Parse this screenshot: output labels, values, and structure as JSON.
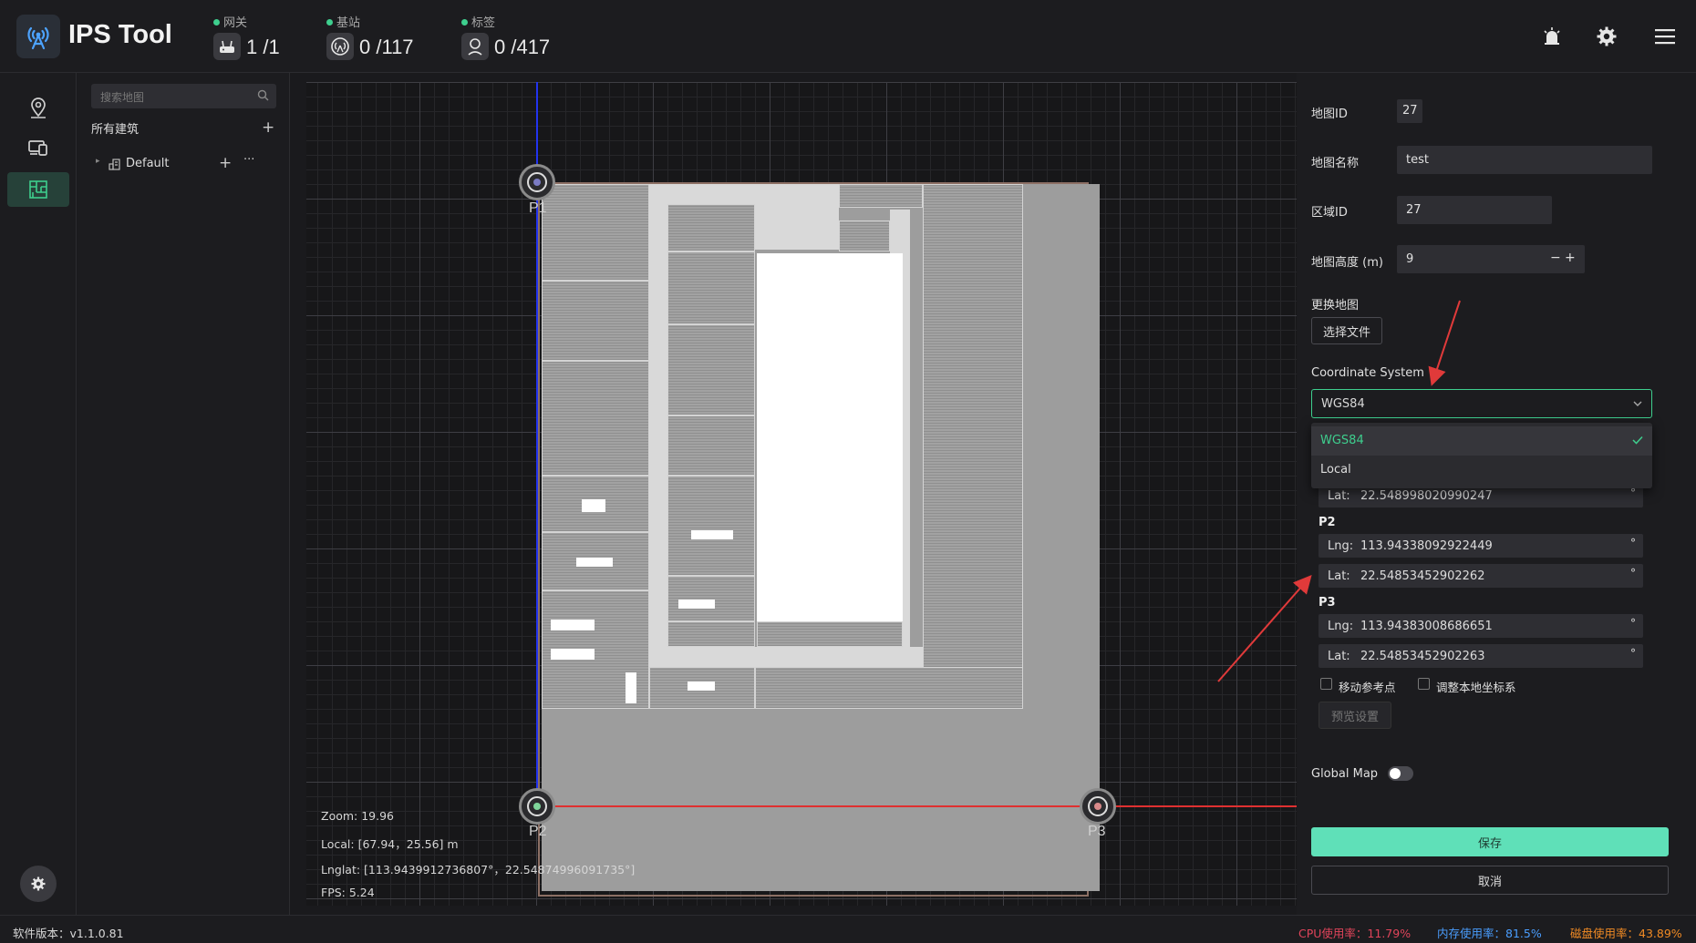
{
  "header": {
    "app_title": "IPS Tool",
    "stats": [
      {
        "label": "网关",
        "value": "1 /1"
      },
      {
        "label": "基站",
        "value": "0 /117"
      },
      {
        "label": "标签",
        "value": "0 /417"
      }
    ]
  },
  "sidebar": {
    "icons": [
      "location-pin-icon",
      "devices-icon",
      "floor-map-icon"
    ],
    "active": "floor-map-icon"
  },
  "tree": {
    "search_placeholder": "搜索地图",
    "all_buildings_label": "所有建筑",
    "default_node_label": "Default",
    "add_symbol": "+",
    "more_symbol": "···"
  },
  "canvas": {
    "point_labels": [
      "P1",
      "P2",
      "P3"
    ],
    "zoom": "Zoom:  19.96",
    "local": "Local:  [67.94，25.56] m",
    "lnglat": "Lnglat:  [113.9439912736807°，22.54874996091735°]",
    "fps": "FPS:  5.24"
  },
  "form": {
    "map_id_label": "地图ID",
    "map_id_value": "27",
    "map_name_label": "地图名称",
    "map_name_value": "test",
    "area_id_label": "区域ID",
    "area_id_value": "27",
    "height_label": "地图高度 (m)",
    "height_value": "9",
    "stepper_minus": "−",
    "stepper_plus": "+",
    "replace_map_label": "更换地图",
    "choose_file_button": "选择文件",
    "coord_system_label": "Coordinate System",
    "coord_system_value": "WGS84",
    "coord_system_options": [
      "WGS84",
      "Local"
    ],
    "p1_lat_value": "22.548998020990247",
    "points": [
      {
        "name": "P2",
        "lng": "113.94338092922449",
        "lat": "22.54853452902262"
      },
      {
        "name": "P3",
        "lng": "113.94383008686651",
        "lat": "22.54853452902263"
      }
    ],
    "lng_prefix": "Lng:",
    "lat_prefix": "Lat:",
    "degree_unit": "°",
    "move_ref_label": "移动参考点",
    "adjust_local_label": "调整本地坐标系",
    "preview_button": "预览设置",
    "global_map_label": "Global Map",
    "global_map_on": false,
    "save_button": "保存",
    "cancel_button": "取消"
  },
  "footer": {
    "version": "软件版本：v1.1.0.81",
    "cpu": "CPU使用率：11.79%",
    "memory": "内存使用率：81.5%",
    "disk": "磁盘使用率：43.89%"
  },
  "colors": {
    "accent": "#3ecf8e",
    "cpu": "#e0445a",
    "memory": "#4a9eff",
    "disk": "#f08a24",
    "x_axis": "#e03030",
    "y_axis": "#2233ee"
  }
}
